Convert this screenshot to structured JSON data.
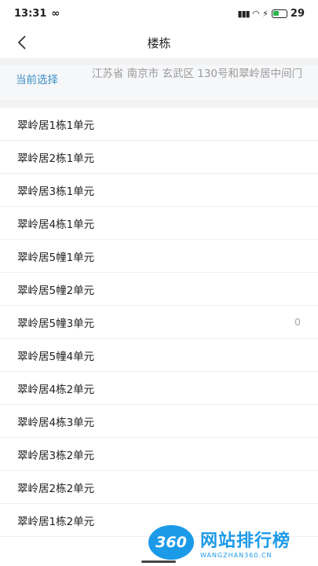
{
  "status": {
    "time": "13:31",
    "battery": "29"
  },
  "nav": {
    "title": "楼栋"
  },
  "current": {
    "label": "当前选择",
    "value": "江苏省 南京市 玄武区 130号和翠岭居中间门"
  },
  "items": [
    {
      "label": "翠岭居1栋1单元",
      "count": ""
    },
    {
      "label": "翠岭居2栋1单元",
      "count": ""
    },
    {
      "label": "翠岭居3栋1单元",
      "count": ""
    },
    {
      "label": "翠岭居4栋1单元",
      "count": ""
    },
    {
      "label": "翠岭居5幢1单元",
      "count": ""
    },
    {
      "label": "翠岭居5幢2单元",
      "count": ""
    },
    {
      "label": "翠岭居5幢3单元",
      "count": "0"
    },
    {
      "label": "翠岭居5幢4单元",
      "count": ""
    },
    {
      "label": "翠岭居4栋2单元",
      "count": ""
    },
    {
      "label": "翠岭居4栋3单元",
      "count": ""
    },
    {
      "label": "翠岭居3栋2单元",
      "count": ""
    },
    {
      "label": "翠岭居2栋2单元",
      "count": ""
    },
    {
      "label": "翠岭居1栋2单元",
      "count": ""
    }
  ],
  "watermark": {
    "logo": "360",
    "title": "网站排行榜",
    "url": "WANGZHAN360.CN"
  },
  "colors": {
    "accent": "#3a8fc4",
    "watermark": "#1b9ae8",
    "battery": "#2db34a"
  }
}
